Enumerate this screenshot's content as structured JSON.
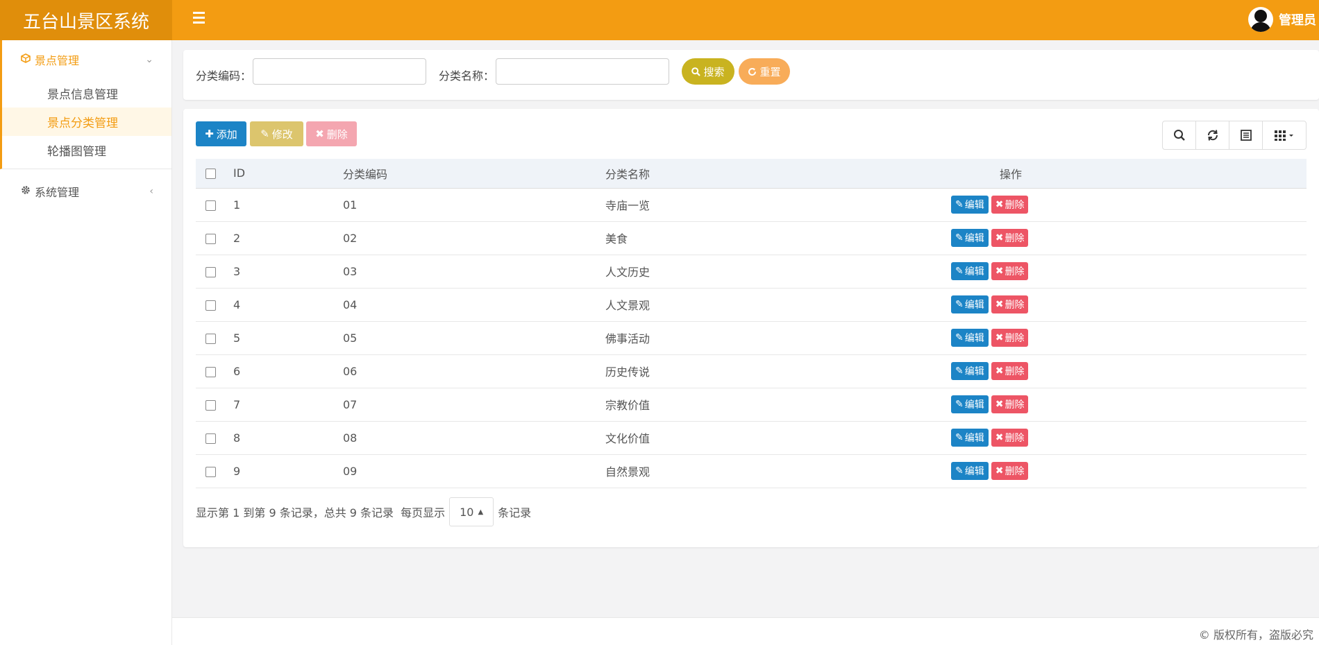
{
  "app": {
    "title": "五台山景区系统",
    "user_name": "管理员"
  },
  "sidebar": {
    "group1": {
      "label": "景点管理",
      "items": [
        "景点信息管理",
        "景点分类管理",
        "轮播图管理"
      ]
    },
    "group2": {
      "label": "系统管理"
    }
  },
  "search": {
    "code_label": "分类编码：",
    "name_label": "分类名称：",
    "search_btn": "搜索",
    "reset_btn": "重置"
  },
  "toolbar": {
    "add": "添加",
    "edit": "修改",
    "delete": "删除"
  },
  "table": {
    "headers": [
      "ID",
      "分类编码",
      "分类名称",
      "操作"
    ],
    "rows": [
      {
        "id": "1",
        "code": "01",
        "name": "寺庙一览"
      },
      {
        "id": "2",
        "code": "02",
        "name": "美食"
      },
      {
        "id": "3",
        "code": "03",
        "name": "人文历史"
      },
      {
        "id": "4",
        "code": "04",
        "name": "人文景观"
      },
      {
        "id": "5",
        "code": "05",
        "name": "佛事活动"
      },
      {
        "id": "6",
        "code": "06",
        "name": "历史传说"
      },
      {
        "id": "7",
        "code": "07",
        "name": "宗教价值"
      },
      {
        "id": "8",
        "code": "08",
        "name": "文化价值"
      },
      {
        "id": "9",
        "code": "09",
        "name": "自然景观"
      }
    ],
    "row_edit": "编辑",
    "row_delete": "删除"
  },
  "pager": {
    "summary": "显示第 1 到第 9 条记录，总共 9 条记录",
    "per_page_prefix": "每页显示",
    "page_size": "10",
    "per_page_suffix": "条记录"
  },
  "footer": {
    "text": "© 版权所有，盗版必究"
  },
  "colors": {
    "header": "#f39c12",
    "logo": "#e08e0b",
    "primary": "#1c84c6",
    "danger": "#ed5565",
    "search": "#c9b320",
    "reset": "#f8ac59"
  }
}
